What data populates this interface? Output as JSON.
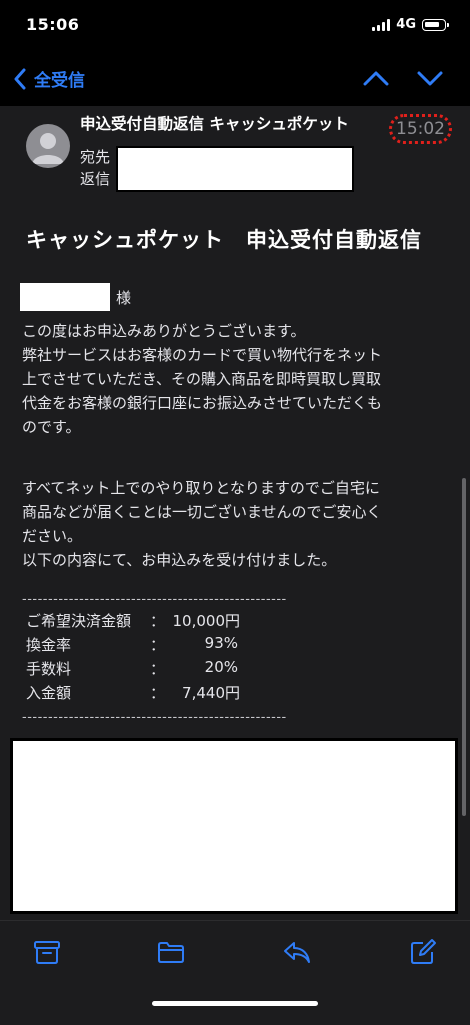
{
  "status_bar": {
    "time": "15:06",
    "network": "4G"
  },
  "nav": {
    "back_label": "全受信"
  },
  "header": {
    "subject": "申込受付自動返信 キャッシュポケット",
    "time": "15:02",
    "to_label": "宛先",
    "reply_label": "返信"
  },
  "body": {
    "title": "キャッシュポケット　申込受付自動返信",
    "honorific": "様",
    "paragraph1": [
      "この度はお申込みありがとうございます。",
      "弊社サービスはお客様のカードで買い物代行をネット",
      "上でさせていただき、その購入商品を即時買取し買取",
      "代金をお客様の銀行口座にお振込みさせていただくも",
      "のです。"
    ],
    "paragraph2": [
      "すべてネット上でのやり取りとなりますのでご自宅に",
      "商品などが届くことは一切ございませんのでご安心く",
      "ださい。",
      "以下の内容にて、お申込みを受け付けました。"
    ],
    "divider": "---------------------------------------------------",
    "fees": [
      {
        "label": "ご希望決済金額",
        "colon": "：",
        "value": "10,000円"
      },
      {
        "label": "換金率",
        "colon": "：",
        "value": "93%"
      },
      {
        "label": "手数料",
        "colon": "：",
        "value": "20%"
      },
      {
        "label": "入金額",
        "colon": "：",
        "value": "7,440円"
      }
    ]
  },
  "colors": {
    "accent": "#2f7cf6",
    "highlight": "#e0201b",
    "background": "#1c1c1e"
  },
  "toolbar": {
    "icons": [
      "archive-icon",
      "folder-icon",
      "reply-icon",
      "compose-icon"
    ]
  }
}
